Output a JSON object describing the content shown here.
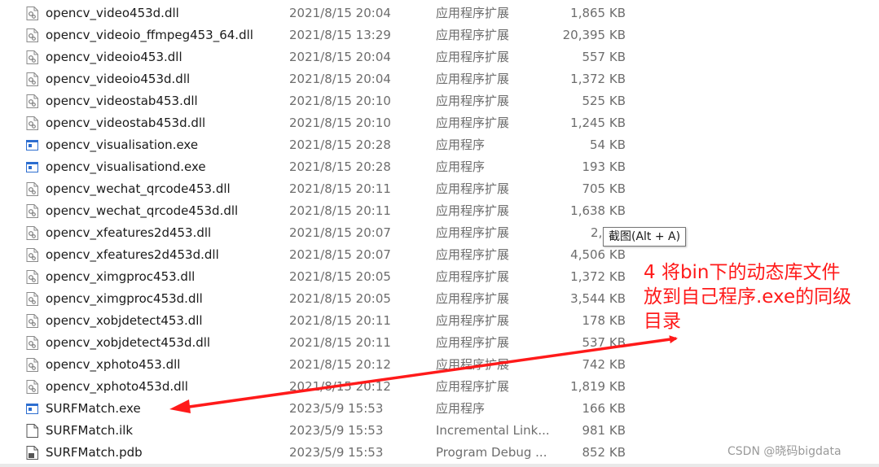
{
  "colors": {
    "annotation": "#ff1a1a",
    "secondary_text": "#6d6d6d",
    "exe_icon_blue": "#2d6ed0"
  },
  "files": [
    {
      "name": "opencv_video453d.dll",
      "date": "2021/8/15 20:04",
      "type": "应用程序扩展",
      "size": "1,865 KB",
      "icon": "dll-icon"
    },
    {
      "name": "opencv_videoio_ffmpeg453_64.dll",
      "date": "2021/8/15 13:29",
      "type": "应用程序扩展",
      "size": "20,395 KB",
      "icon": "dll-icon"
    },
    {
      "name": "opencv_videoio453.dll",
      "date": "2021/8/15 20:04",
      "type": "应用程序扩展",
      "size": "557 KB",
      "icon": "dll-icon"
    },
    {
      "name": "opencv_videoio453d.dll",
      "date": "2021/8/15 20:04",
      "type": "应用程序扩展",
      "size": "1,372 KB",
      "icon": "dll-icon"
    },
    {
      "name": "opencv_videostab453.dll",
      "date": "2021/8/15 20:10",
      "type": "应用程序扩展",
      "size": "525 KB",
      "icon": "dll-icon"
    },
    {
      "name": "opencv_videostab453d.dll",
      "date": "2021/8/15 20:10",
      "type": "应用程序扩展",
      "size": "1,245 KB",
      "icon": "dll-icon"
    },
    {
      "name": "opencv_visualisation.exe",
      "date": "2021/8/15 20:28",
      "type": "应用程序",
      "size": "54 KB",
      "icon": "exe-icon"
    },
    {
      "name": "opencv_visualisationd.exe",
      "date": "2021/8/15 20:28",
      "type": "应用程序",
      "size": "193 KB",
      "icon": "exe-icon"
    },
    {
      "name": "opencv_wechat_qrcode453.dll",
      "date": "2021/8/15 20:11",
      "type": "应用程序扩展",
      "size": "705 KB",
      "icon": "dll-icon"
    },
    {
      "name": "opencv_wechat_qrcode453d.dll",
      "date": "2021/8/15 20:11",
      "type": "应用程序扩展",
      "size": "1,638 KB",
      "icon": "dll-icon"
    },
    {
      "name": "opencv_xfeatures2d453.dll",
      "date": "2021/8/15 20:07",
      "type": "应用程序扩展",
      "size": "2,899",
      "icon": "dll-icon"
    },
    {
      "name": "opencv_xfeatures2d453d.dll",
      "date": "2021/8/15 20:07",
      "type": "应用程序扩展",
      "size": "4,506 KB",
      "icon": "dll-icon"
    },
    {
      "name": "opencv_ximgproc453.dll",
      "date": "2021/8/15 20:05",
      "type": "应用程序扩展",
      "size": "1,372 KB",
      "icon": "dll-icon"
    },
    {
      "name": "opencv_ximgproc453d.dll",
      "date": "2021/8/15 20:05",
      "type": "应用程序扩展",
      "size": "3,544 KB",
      "icon": "dll-icon"
    },
    {
      "name": "opencv_xobjdetect453.dll",
      "date": "2021/8/15 20:11",
      "type": "应用程序扩展",
      "size": "178 KB",
      "icon": "dll-icon"
    },
    {
      "name": "opencv_xobjdetect453d.dll",
      "date": "2021/8/15 20:11",
      "type": "应用程序扩展",
      "size": "537 KB",
      "icon": "dll-icon"
    },
    {
      "name": "opencv_xphoto453.dll",
      "date": "2021/8/15 20:12",
      "type": "应用程序扩展",
      "size": "742 KB",
      "icon": "dll-icon"
    },
    {
      "name": "opencv_xphoto453d.dll",
      "date": "2021/8/15 20:12",
      "type": "应用程序扩展",
      "size": "1,819 KB",
      "icon": "dll-icon"
    },
    {
      "name": "SURFMatch.exe",
      "date": "2023/5/9 15:53",
      "type": "应用程序",
      "size": "166 KB",
      "icon": "exe-icon"
    },
    {
      "name": "SURFMatch.ilk",
      "date": "2023/5/9 15:53",
      "type": "Incremental Link...",
      "size": "981 KB",
      "icon": "file-icon"
    },
    {
      "name": "SURFMatch.pdb",
      "date": "2023/5/9 15:53",
      "type": "Program Debug ...",
      "size": "852 KB",
      "icon": "pdb-icon"
    }
  ],
  "tooltip": {
    "text": "截图(Alt + A)"
  },
  "annotation": {
    "line1": "4 将bin下的动态库文件",
    "line2": "放到自己程序.exe的同级",
    "line3": "目录"
  },
  "watermark": {
    "text": "CSDN @晓码bigdata"
  }
}
